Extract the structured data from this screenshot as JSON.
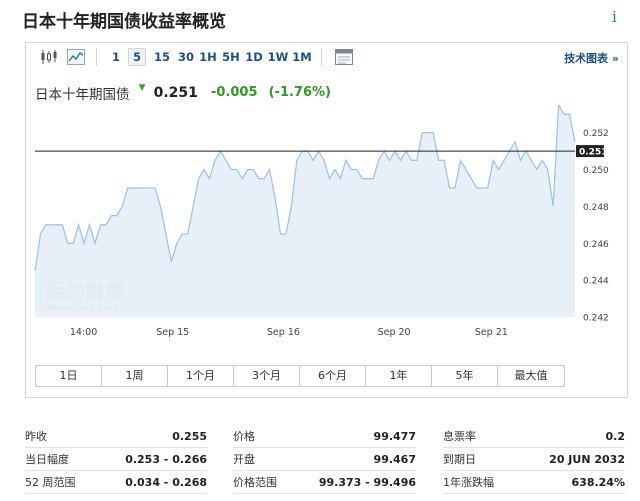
{
  "page": {
    "title": "日本十年期国债收益率概览",
    "info_icon": "i"
  },
  "toolbar": {
    "icons": [
      "candlestick-icon",
      "area-chart-icon",
      "calendar-icon"
    ],
    "timeframes": [
      "1",
      "5",
      "15",
      "30",
      "1H",
      "5H",
      "1D",
      "1W",
      "1M"
    ],
    "active_timeframe": "5",
    "tech_chart_link": "技术图表 »"
  },
  "quote": {
    "name": "日本十年期国债",
    "direction_icon": "triangle-down-icon",
    "price": "0.251",
    "change": "-0.005",
    "change_percent": "(-1.76%)",
    "up_color": "#2e9a22"
  },
  "watermark": {
    "cn": "英为财情",
    "en": "Investing.com"
  },
  "chart_data": {
    "type": "area",
    "x_tick_labels": [
      "14:00",
      "Sep 15",
      "Sep 16",
      "Sep 20",
      "Sep 21"
    ],
    "y_tick_labels": [
      "0.252",
      "0.250",
      "0.248",
      "0.246",
      "0.244",
      "0.242"
    ],
    "ylim": [
      0.242,
      0.2535
    ],
    "reference_line": 0.251,
    "current_value_label": "0.251",
    "line_color": "#9ec5e8",
    "fill_color": "#e4eef7",
    "values": [
      0.2445,
      0.2465,
      0.247,
      0.247,
      0.247,
      0.247,
      0.246,
      0.246,
      0.247,
      0.246,
      0.247,
      0.246,
      0.247,
      0.247,
      0.2475,
      0.2475,
      0.248,
      0.249,
      0.249,
      0.249,
      0.249,
      0.249,
      0.249,
      0.248,
      0.2465,
      0.245,
      0.246,
      0.2465,
      0.2465,
      0.248,
      0.2495,
      0.25,
      0.2495,
      0.2505,
      0.251,
      0.2505,
      0.25,
      0.25,
      0.2495,
      0.25,
      0.25,
      0.2495,
      0.2495,
      0.25,
      0.2485,
      0.2465,
      0.2465,
      0.248,
      0.2505,
      0.251,
      0.251,
      0.2505,
      0.251,
      0.2505,
      0.2495,
      0.25,
      0.2495,
      0.2505,
      0.25,
      0.25,
      0.2495,
      0.2495,
      0.2495,
      0.2505,
      0.251,
      0.2505,
      0.251,
      0.2505,
      0.251,
      0.2505,
      0.2505,
      0.252,
      0.252,
      0.252,
      0.2505,
      0.2505,
      0.249,
      0.249,
      0.2505,
      0.25,
      0.2495,
      0.249,
      0.249,
      0.249,
      0.2505,
      0.25,
      0.2505,
      0.251,
      0.2515,
      0.2505,
      0.251,
      0.2505,
      0.25,
      0.2505,
      0.25,
      0.248,
      0.2535,
      0.253,
      0.253,
      0.2515
    ]
  },
  "range_buttons": [
    "1日",
    "1周",
    "1个月",
    "3个月",
    "6个月",
    "1年",
    "5年",
    "最大值"
  ],
  "stats": {
    "col1": [
      {
        "label": "昨收",
        "value": "0.255"
      },
      {
        "label": "当日幅度",
        "value": "0.253 - 0.266"
      },
      {
        "label": "52 周范围",
        "value": "0.034 - 0.268"
      }
    ],
    "col2": [
      {
        "label": "价格",
        "value": "99.477"
      },
      {
        "label": "开盘",
        "value": "99.467"
      },
      {
        "label": "价格范围",
        "value": "99.373 - 99.496"
      }
    ],
    "col3": [
      {
        "label": "息票率",
        "value": "0.2"
      },
      {
        "label": "到期日",
        "value": "20 JUN 2032"
      },
      {
        "label": "1年涨跌幅",
        "value": "638.24%"
      }
    ]
  }
}
